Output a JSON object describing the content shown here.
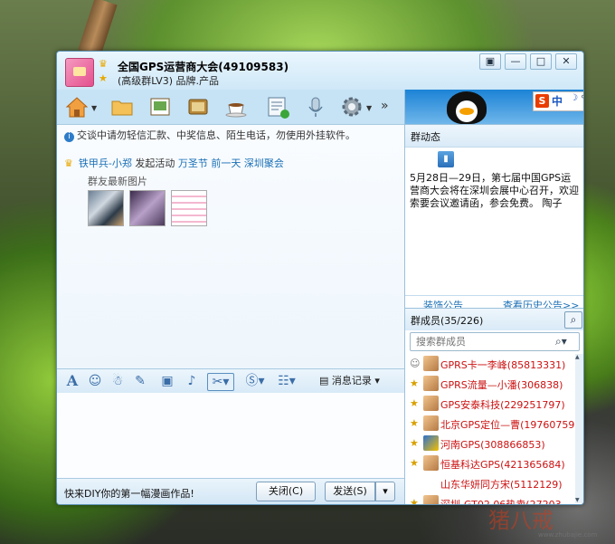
{
  "window": {
    "title": "全国GPS运营商大会(49109583)",
    "subtitle": "(高级群LV3) 品牌.产品",
    "controls": [
      "▣",
      "—",
      "□",
      "✕"
    ]
  },
  "toolbar": {
    "icons": [
      "home-icon",
      "folder-icon",
      "album-icon",
      "video-icon",
      "coffee-icon",
      "note-icon",
      "microphone-icon",
      "gear-icon"
    ],
    "more": "»"
  },
  "chat": {
    "notice": "交谈中请勿轻信汇款、中奖信息、陌生电话，勿使用外挂软件。",
    "activity": {
      "user": "铁甲兵-小郑",
      "action": "发起活动",
      "event": "万圣节 前一天",
      "place": "深圳聚会"
    },
    "pics_label": "群友最新图片"
  },
  "format_bar": {
    "history_label": "消息记录"
  },
  "bottom": {
    "promo": "快来DIY你的第一幅漫画作品!",
    "close_label": "关闭(C)",
    "send_label": "发送(S)"
  },
  "ime": {
    "s": "S",
    "zh": "中",
    "moon": "☽",
    "dot": "°,"
  },
  "group_news": {
    "header": "群动态",
    "text": "5月28日—29日，第七届中国GPS运营商大会将在深圳会展中心召开，欢迎索要会议邀请函，参会免费。 陶子",
    "post_link": "装饰公告",
    "history_link": "查看历史公告>>"
  },
  "members": {
    "header": "群成员(35/226)",
    "search_placeholder": "搜索群成员",
    "list": [
      {
        "name": "GPRS卡一李峰(85813331)"
      },
      {
        "name": "GPRS流量—小潘(306838)"
      },
      {
        "name": "GPS安泰科技(229251797)"
      },
      {
        "name": "北京GPS定位—曹(19760759)"
      },
      {
        "name": "河南GPS(308866853)"
      },
      {
        "name": "恒基科达GPS(421365684)"
      },
      {
        "name": "山东华妍同方宋(5112129)"
      },
      {
        "name": "深圳-GT02 06热卖(27203..."
      }
    ]
  },
  "watermark": {
    "main": "猪八戒",
    "small": "www.zhubajie.com"
  }
}
